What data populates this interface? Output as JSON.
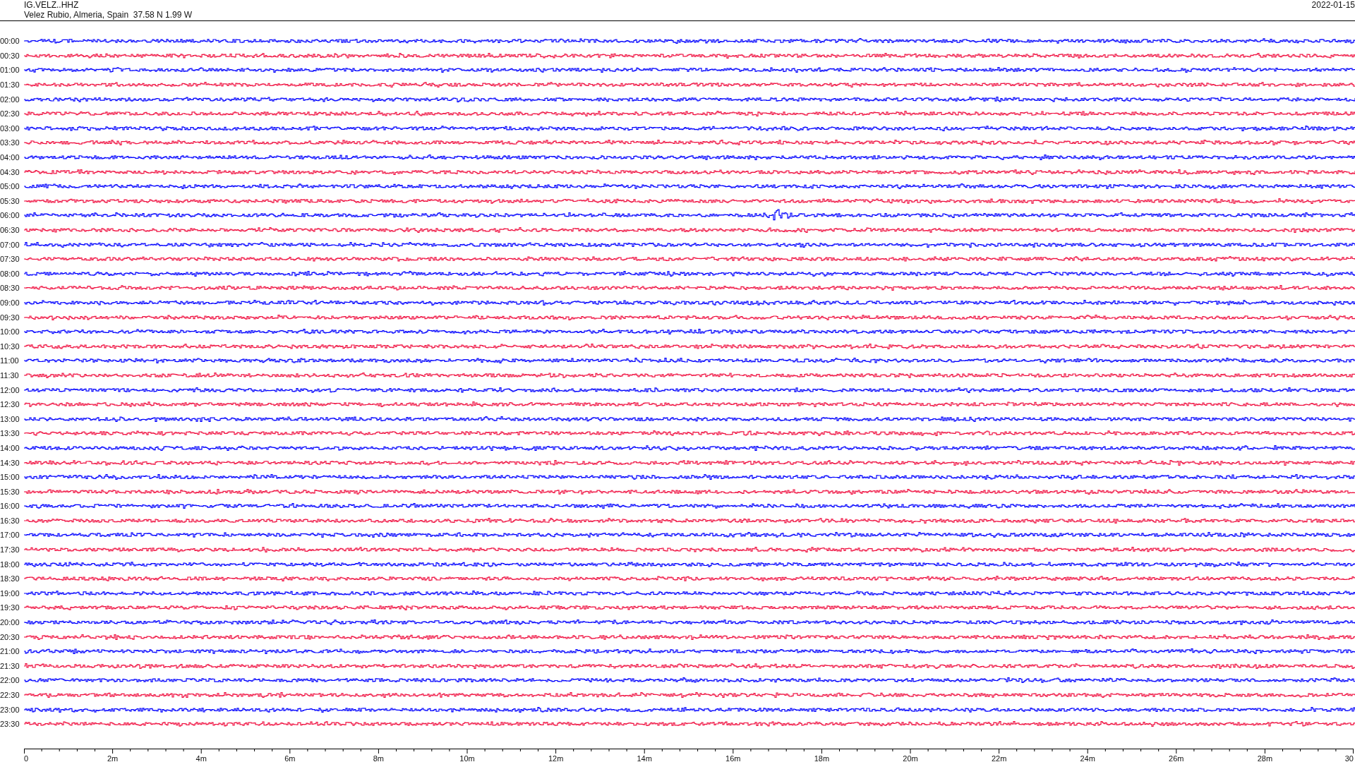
{
  "header": {
    "station": "IG.VELZ..HHZ",
    "location": "Velez Rubio, Almeria, Spain  37.58 N 1.99 W",
    "date": "2022-01-15"
  },
  "rows": [
    {
      "time": "00:00",
      "color": "#0000ff",
      "event": false
    },
    {
      "time": "00:30",
      "color": "#f01040",
      "event": false
    },
    {
      "time": "01:00",
      "color": "#0000ff",
      "event": false
    },
    {
      "time": "01:30",
      "color": "#f01040",
      "event": false
    },
    {
      "time": "02:00",
      "color": "#0000ff",
      "event": false
    },
    {
      "time": "02:30",
      "color": "#f01040",
      "event": false
    },
    {
      "time": "03:00",
      "color": "#0000ff",
      "event": false
    },
    {
      "time": "03:30",
      "color": "#f01040",
      "event": false
    },
    {
      "time": "04:00",
      "color": "#0000ff",
      "event": false
    },
    {
      "time": "04:30",
      "color": "#f01040",
      "event": false
    },
    {
      "time": "05:00",
      "color": "#0000ff",
      "event": false
    },
    {
      "time": "05:30",
      "color": "#f01040",
      "event": false
    },
    {
      "time": "06:00",
      "color": "#0000ff",
      "event": true
    },
    {
      "time": "06:30",
      "color": "#f01040",
      "event": false
    },
    {
      "time": "07:00",
      "color": "#0000ff",
      "event": false
    },
    {
      "time": "07:30",
      "color": "#f01040",
      "event": false
    },
    {
      "time": "08:00",
      "color": "#0000ff",
      "event": false
    },
    {
      "time": "08:30",
      "color": "#f01040",
      "event": false
    },
    {
      "time": "09:00",
      "color": "#0000ff",
      "event": false
    },
    {
      "time": "09:30",
      "color": "#f01040",
      "event": false
    },
    {
      "time": "10:00",
      "color": "#0000ff",
      "event": false
    },
    {
      "time": "10:30",
      "color": "#f01040",
      "event": false
    },
    {
      "time": "11:00",
      "color": "#0000ff",
      "event": false
    },
    {
      "time": "11:30",
      "color": "#f01040",
      "event": false
    },
    {
      "time": "12:00",
      "color": "#0000ff",
      "event": false
    },
    {
      "time": "12:30",
      "color": "#f01040",
      "event": false
    },
    {
      "time": "13:00",
      "color": "#0000ff",
      "event": false
    },
    {
      "time": "13:30",
      "color": "#f01040",
      "event": false
    },
    {
      "time": "14:00",
      "color": "#0000ff",
      "event": false
    },
    {
      "time": "14:30",
      "color": "#f01040",
      "event": false
    },
    {
      "time": "15:00",
      "color": "#0000ff",
      "event": false
    },
    {
      "time": "15:30",
      "color": "#f01040",
      "event": false
    },
    {
      "time": "16:00",
      "color": "#0000ff",
      "event": false
    },
    {
      "time": "16:30",
      "color": "#f01040",
      "event": false
    },
    {
      "time": "17:00",
      "color": "#0000ff",
      "event": false
    },
    {
      "time": "17:30",
      "color": "#f01040",
      "event": false
    },
    {
      "time": "18:00",
      "color": "#0000ff",
      "event": false
    },
    {
      "time": "18:30",
      "color": "#f01040",
      "event": false
    },
    {
      "time": "19:00",
      "color": "#0000ff",
      "event": false
    },
    {
      "time": "19:30",
      "color": "#f01040",
      "event": false
    },
    {
      "time": "20:00",
      "color": "#0000ff",
      "event": false
    },
    {
      "time": "20:30",
      "color": "#f01040",
      "event": false
    },
    {
      "time": "21:00",
      "color": "#0000ff",
      "event": false
    },
    {
      "time": "21:30",
      "color": "#f01040",
      "event": false
    },
    {
      "time": "22:00",
      "color": "#0000ff",
      "event": false
    },
    {
      "time": "22:30",
      "color": "#f01040",
      "event": false
    },
    {
      "time": "23:00",
      "color": "#0000ff",
      "event": false
    },
    {
      "time": "23:30",
      "color": "#f01040",
      "event": false
    }
  ],
  "time_axis": {
    "ticks": [
      "0",
      "2m",
      "4m",
      "6m",
      "8m",
      "10m",
      "12m",
      "14m",
      "16m",
      "18m",
      "20m",
      "22m",
      "24m",
      "26m",
      "28m",
      "30"
    ]
  }
}
